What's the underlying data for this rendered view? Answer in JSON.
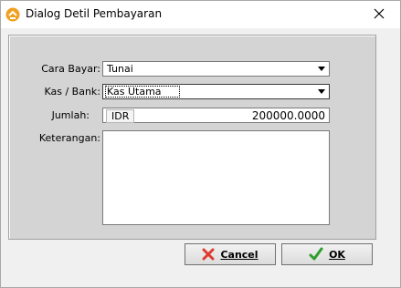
{
  "window": {
    "title": "Dialog Detil Pembayaran",
    "icons": {
      "app": "app-logo-icon",
      "close": "close-icon"
    }
  },
  "form": {
    "cara_bayar": {
      "label": "Cara Bayar:",
      "value": "Tunai"
    },
    "kas_bank": {
      "label": "Kas / Bank:",
      "value": "Kas Utama"
    },
    "jumlah": {
      "label": "Jumlah:",
      "currency": "IDR",
      "value": "200000.0000"
    },
    "keterangan": {
      "label": "Keterangan:",
      "value": ""
    }
  },
  "buttons": {
    "cancel": {
      "label": "Cancel",
      "icon": "red-x-icon"
    },
    "ok": {
      "label": "OK",
      "icon": "green-check-icon"
    }
  },
  "colors": {
    "panel_bg": "#d4d4d4",
    "client_bg": "#f0f0f0",
    "cancel_icon": "#e03a2e",
    "ok_icon": "#2e9d2e",
    "app_icon": "#f0a020"
  }
}
